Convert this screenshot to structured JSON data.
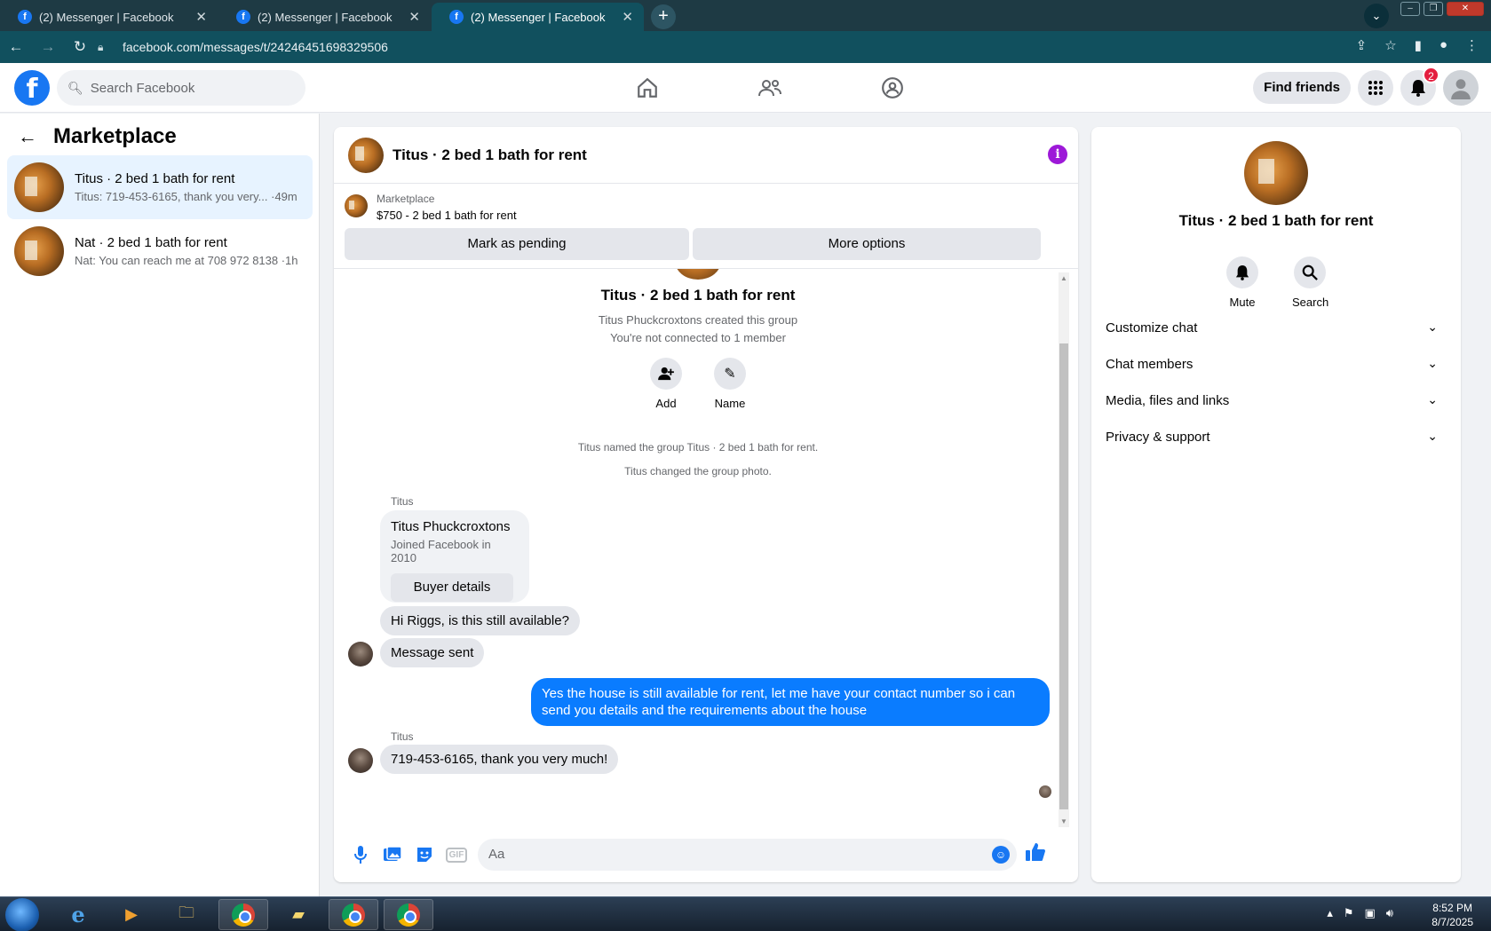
{
  "browser": {
    "tabs": [
      {
        "title": "(2) Messenger | Facebook"
      },
      {
        "title": "(2) Messenger | Facebook"
      },
      {
        "title": "(2) Messenger | Facebook"
      }
    ],
    "url": "facebook.com/messages/t/24246451698329506"
  },
  "header": {
    "search_placeholder": "Search Facebook",
    "find_friends": "Find friends",
    "notification_count": "2"
  },
  "sidebar": {
    "title": "Marketplace",
    "conversations": [
      {
        "name": "Titus · 2 bed 1 bath for rent",
        "snippet": "Titus: 719-453-6165, thank you very... ·49m"
      },
      {
        "name": "Nat · 2 bed 1 bath for rent",
        "snippet": "Nat: You can reach me at 708 972 8138 ·1h"
      }
    ]
  },
  "chat": {
    "title": "Titus · 2 bed 1 bath for rent",
    "marketplace_label": "Marketplace",
    "listing": "$750 - 2 bed 1 bath for rent",
    "mark_pending": "Mark as pending",
    "more_options": "More options",
    "group_title": "Titus · 2 bed 1 bath for rent",
    "created_by": "Titus Phuckcroxtons created this group",
    "not_connected": "You're not connected to 1 member",
    "add_label": "Add",
    "name_label": "Name",
    "sys_named": "Titus named the group Titus · 2 bed 1 bath for rent.",
    "sys_photo": "Titus changed the group photo.",
    "sender_1": "Titus",
    "card_name": "Titus Phuckcroxtons",
    "card_joined": "Joined Facebook in 2010",
    "buyer_details": "Buyer details",
    "msg_1": "Hi Riggs, is this still available?",
    "msg_2": "Message sent",
    "msg_me": "Yes the house is still available for rent, let me have your contact number so i can send you details and the requirements about the house",
    "sender_2": "Titus",
    "msg_3": "719-453-6165, thank you very much!",
    "composer_placeholder": "Aa",
    "gif_label": "GIF"
  },
  "rpanel": {
    "title": "Titus · 2 bed 1 bath for rent",
    "mute": "Mute",
    "search": "Search",
    "items": [
      "Customize chat",
      "Chat members",
      "Media, files and links",
      "Privacy & support"
    ]
  },
  "taskbar": {
    "time": "8:52 PM",
    "date": "8/7/2025"
  },
  "colors": {
    "fb_blue": "#1877f2",
    "my_bubble": "#0a7cff",
    "info_purple": "#9d19d8",
    "active_conv": "#e7f3ff"
  }
}
